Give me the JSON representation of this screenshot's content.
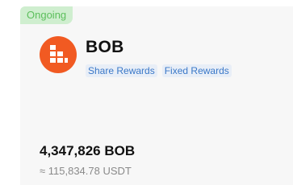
{
  "status": {
    "label": "Ongoing",
    "color": "#5cbf5c",
    "background": "#cfeecf"
  },
  "token": {
    "name": "BOB",
    "logo_icon": "bob-logo-icon",
    "logo_color": "#f15a22"
  },
  "tags": [
    {
      "label": "Share Rewards"
    },
    {
      "label": "Fixed Rewards"
    }
  ],
  "rewards": {
    "amount": "4,347,826 BOB",
    "usdt_value": "≈ 115,834.78 USDT"
  },
  "colors": {
    "tag_text": "#3a78c8",
    "tag_background": "#e8eef7",
    "card_background": "#f7f7f7"
  }
}
